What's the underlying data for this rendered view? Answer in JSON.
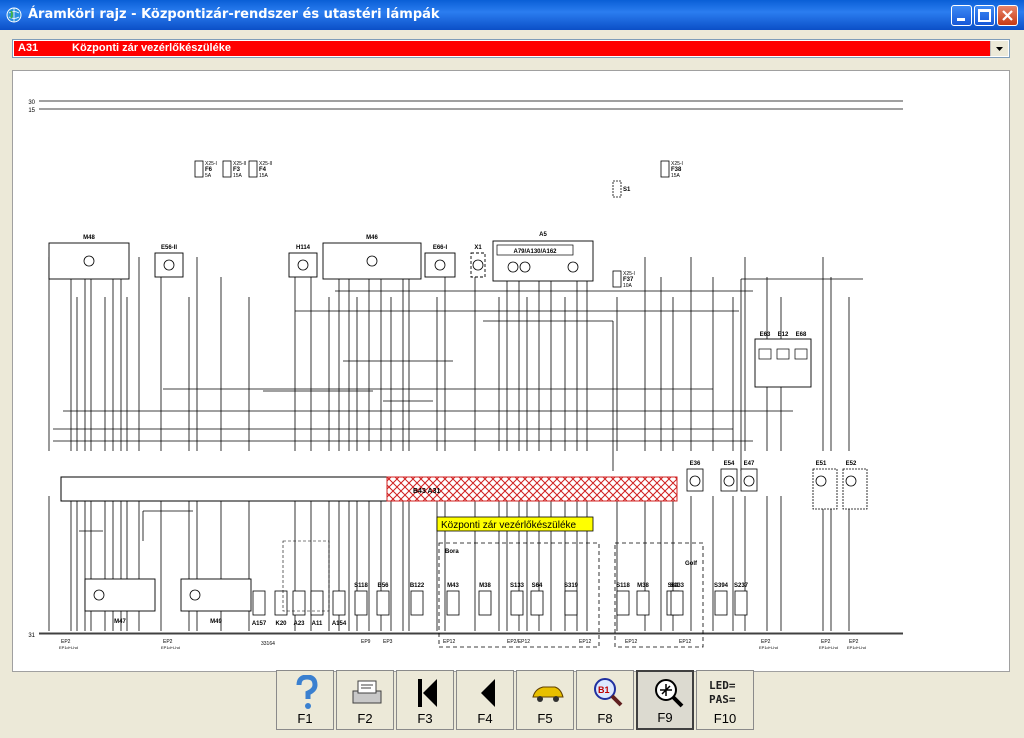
{
  "window": {
    "title": "Áramköri rajz - Központizár-rendszer és utastéri lámpák"
  },
  "selector": {
    "code": "A31",
    "name": "Központi zár vezérlőkészüléke"
  },
  "diagram": {
    "tooltip": "Központi zár vezérlőkészüléke",
    "rail_labels": [
      "30",
      "15",
      "31"
    ],
    "highlight_label": "B43 A31",
    "module_top": "A5",
    "module_inner": "A79/A130/A162",
    "group_bora": "Bora",
    "group_golf": "Golf",
    "ref_number": "33164",
    "fuse_labels": [
      "F6",
      "F3",
      "F4",
      "S1",
      "F38",
      "F37"
    ],
    "fuse_ratings": [
      "5A",
      "15A",
      "15A",
      "",
      "15A",
      "10A"
    ],
    "fuse_feeds": [
      "X25-I",
      "X25-II",
      "X25-II",
      "",
      "X25-I",
      "X25-I"
    ],
    "top_components": [
      "M48",
      "E56-II",
      "H114",
      "M46",
      "E66-I",
      "X1",
      "E63",
      "E12",
      "E68"
    ],
    "bottom_components": [
      "M47",
      "M49",
      "A157",
      "K20",
      "A23",
      "A11",
      "A154",
      "S118",
      "B56",
      "B122",
      "M43",
      "M38",
      "S133",
      "S64",
      "S319",
      "S118",
      "M38",
      "S64",
      "S133",
      "S394",
      "S237",
      "E36",
      "E54",
      "E47",
      "E51",
      "E52"
    ],
    "ground_labels": [
      "EP2",
      "EP2",
      "EP9",
      "EP3",
      "EP12",
      "EP2/EP12",
      "EP12",
      "EP12",
      "EP12",
      "EP2",
      "EP2",
      "EP2"
    ],
    "ground_sublabels": [
      "EP1d+Lhd",
      "EP1d+Lhd",
      "",
      "",
      "",
      "",
      "",
      "",
      "",
      "EP1d+Lhd",
      "EP1d+Lhd",
      "EP1d+Lhd"
    ]
  },
  "toolbar": {
    "keys": [
      {
        "label": "F1",
        "icon": "help-icon"
      },
      {
        "label": "F2",
        "icon": "printer-icon"
      },
      {
        "label": "F3",
        "icon": "first-page-icon"
      },
      {
        "label": "F4",
        "icon": "previous-page-icon"
      },
      {
        "label": "F5",
        "icon": "car-icon"
      },
      {
        "label": "F8",
        "icon": "component-search-icon"
      },
      {
        "label": "F9",
        "icon": "ground-point-search-icon"
      },
      {
        "label": "F10",
        "icon": "led-pass-icon"
      }
    ],
    "led_text_1": "LED=",
    "led_text_2": "PAS="
  },
  "colors": {
    "title_bar": "#0a5fd6",
    "selector_highlight": "#ff0000",
    "tooltip_bg": "#ffff00",
    "hatch": "#d02020"
  }
}
